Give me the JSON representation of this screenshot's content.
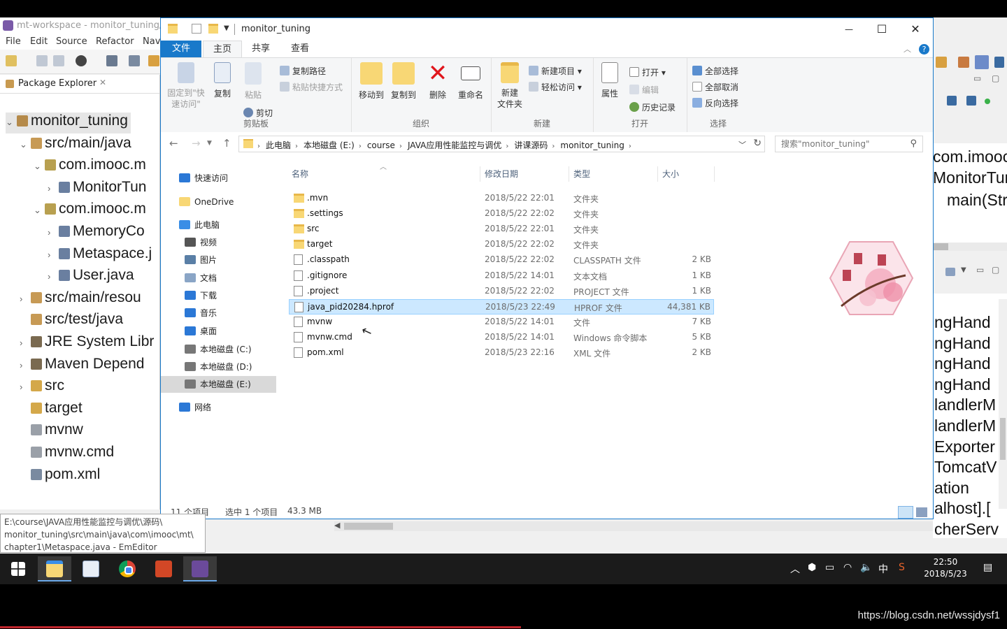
{
  "eclipse": {
    "title": "mt-workspace - monitor_tuning/s",
    "menu": [
      "File",
      "Edit",
      "Source",
      "Refactor",
      "Nav"
    ],
    "package_explorer": {
      "tab_label": "Package Explorer",
      "tree": [
        {
          "label": "monitor_tuning",
          "arrow": "v",
          "indent": 0,
          "icon": "project-icon"
        },
        {
          "label": "src/main/java",
          "arrow": "v",
          "indent": 1,
          "icon": "source-folder-icon"
        },
        {
          "label": "com.imooc.m",
          "arrow": "v",
          "indent": 2,
          "icon": "package-icon"
        },
        {
          "label": "MonitorTun",
          "arrow": ">",
          "indent": 3,
          "icon": "java-file-icon"
        },
        {
          "label": "com.imooc.m",
          "arrow": "v",
          "indent": 2,
          "icon": "package-icon"
        },
        {
          "label": "MemoryCo",
          "arrow": ">",
          "indent": 3,
          "icon": "java-file-icon"
        },
        {
          "label": "Metaspace.j",
          "arrow": ">",
          "indent": 3,
          "icon": "java-file-icon"
        },
        {
          "label": "User.java",
          "arrow": ">",
          "indent": 3,
          "icon": "java-file-icon"
        },
        {
          "label": "src/main/resou",
          "arrow": ">",
          "indent": 1,
          "icon": "source-folder-icon"
        },
        {
          "label": "src/test/java",
          "arrow": "",
          "indent": 1,
          "icon": "source-folder-icon"
        },
        {
          "label": "JRE System Libr",
          "arrow": ">",
          "indent": 1,
          "icon": "library-icon"
        },
        {
          "label": "Maven Depend",
          "arrow": ">",
          "indent": 1,
          "icon": "library-icon"
        },
        {
          "label": "src",
          "arrow": ">",
          "indent": 1,
          "icon": "folder-icon"
        },
        {
          "label": "target",
          "arrow": "",
          "indent": 1,
          "icon": "folder-icon"
        },
        {
          "label": "mvnw",
          "arrow": "",
          "indent": 1,
          "icon": "file-icon"
        },
        {
          "label": "mvnw.cmd",
          "arrow": "",
          "indent": 1,
          "icon": "file-icon"
        },
        {
          "label": "pom.xml",
          "arrow": "",
          "indent": 1,
          "icon": "xml-file-icon"
        }
      ]
    },
    "tooltip": {
      "line1": "E:\\course\\JAVA应用性能监控与调优\\源码\\",
      "line2": "monitor_tuning\\src\\main\\java\\com\\imooc\\mt\\",
      "line3": "chapter1\\Metaspace.java - EmEditor"
    },
    "right_editor_lines": [
      "com.imooc",
      "MonitorTur",
      "main(Str"
    ],
    "right_console_lines": [
      "ngHand",
      "ngHand",
      "ngHand",
      "ngHand",
      "landlerM",
      "landlerM",
      "Exporter",
      "TomcatV",
      "ation",
      "alhost].[",
      "cherServ"
    ]
  },
  "explorer": {
    "title": "monitor_tuning",
    "window_controls": {
      "minimize": "—",
      "maximize": "☐",
      "close": "✕"
    },
    "tabs": [
      "文件",
      "主页",
      "共享",
      "查看"
    ],
    "ribbon": {
      "clipboard": {
        "label": "剪贴板",
        "pin": "固定到\"快\n速访问\"",
        "copy": "复制",
        "paste": "粘贴",
        "copy_path": "复制路径",
        "paste_shortcut": "粘贴快捷方式",
        "cut": "剪切"
      },
      "organize": {
        "label": "组织",
        "move_to": "移动到",
        "copy_to": "复制到",
        "delete": "删除",
        "rename": "重命名"
      },
      "new": {
        "label": "新建",
        "new_folder": "新建\n文件夹",
        "new_item": "新建项目",
        "easy_access": "轻松访问"
      },
      "open": {
        "label": "打开",
        "properties": "属性",
        "open": "打开",
        "edit": "编辑",
        "history": "历史记录"
      },
      "select": {
        "label": "选择",
        "select_all": "全部选择",
        "select_none": "全部取消",
        "invert": "反向选择"
      }
    },
    "breadcrumbs": [
      "此电脑",
      "本地磁盘 (E:)",
      "course",
      "JAVA应用性能监控与调优",
      "讲课源码",
      "monitor_tuning"
    ],
    "search_placeholder": "搜索\"monitor_tuning\"",
    "nav": [
      {
        "label": "快速访问",
        "icon": "star-icon",
        "color": "#2b78d6"
      },
      {
        "label": "OneDrive",
        "icon": "onedrive-icon",
        "color": "#f8d775"
      },
      {
        "label": "此电脑",
        "icon": "pc-icon",
        "color": "#3a8ee6"
      },
      {
        "label": "视频",
        "icon": "video-icon",
        "color": "#555"
      },
      {
        "label": "图片",
        "icon": "picture-icon",
        "color": "#5a7fa6"
      },
      {
        "label": "文档",
        "icon": "document-icon",
        "color": "#8aa5c6"
      },
      {
        "label": "下载",
        "icon": "download-icon",
        "color": "#2b78d6"
      },
      {
        "label": "音乐",
        "icon": "music-icon",
        "color": "#2b78d6"
      },
      {
        "label": "桌面",
        "icon": "desktop-icon",
        "color": "#2b78d6"
      },
      {
        "label": "本地磁盘 (C:)",
        "icon": "drive-icon",
        "color": "#777"
      },
      {
        "label": "本地磁盘 (D:)",
        "icon": "drive-icon",
        "color": "#777"
      },
      {
        "label": "本地磁盘 (E:)",
        "icon": "drive-icon",
        "color": "#777"
      },
      {
        "label": "网络",
        "icon": "network-icon",
        "color": "#2b78d6"
      }
    ],
    "columns": {
      "name": "名称",
      "date": "修改日期",
      "type": "类型",
      "size": "大小"
    },
    "files": [
      {
        "name": ".mvn",
        "date": "2018/5/22 22:01",
        "type": "文件夹",
        "size": "",
        "kind": "folder"
      },
      {
        "name": ".settings",
        "date": "2018/5/22 22:02",
        "type": "文件夹",
        "size": "",
        "kind": "folder"
      },
      {
        "name": "src",
        "date": "2018/5/22 22:01",
        "type": "文件夹",
        "size": "",
        "kind": "folder"
      },
      {
        "name": "target",
        "date": "2018/5/22 22:02",
        "type": "文件夹",
        "size": "",
        "kind": "folder"
      },
      {
        "name": ".classpath",
        "date": "2018/5/22 22:02",
        "type": "CLASSPATH 文件",
        "size": "2 KB",
        "kind": "doc"
      },
      {
        "name": ".gitignore",
        "date": "2018/5/22 14:01",
        "type": "文本文档",
        "size": "1 KB",
        "kind": "doc"
      },
      {
        "name": ".project",
        "date": "2018/5/22 22:02",
        "type": "PROJECT 文件",
        "size": "1 KB",
        "kind": "doc"
      },
      {
        "name": "java_pid20284.hprof",
        "date": "2018/5/23 22:49",
        "type": "HPROF 文件",
        "size": "44,381 KB",
        "kind": "doc",
        "selected": true
      },
      {
        "name": "mvnw",
        "date": "2018/5/22 14:01",
        "type": "文件",
        "size": "7 KB",
        "kind": "doc"
      },
      {
        "name": "mvnw.cmd",
        "date": "2018/5/22 14:01",
        "type": "Windows 命令脚本",
        "size": "5 KB",
        "kind": "doc"
      },
      {
        "name": "pom.xml",
        "date": "2018/5/23 22:16",
        "type": "XML 文件",
        "size": "2 KB",
        "kind": "doc"
      }
    ],
    "status": {
      "count": "11 个项目",
      "selection": "选中 1 个项目",
      "size": "43.3 MB"
    }
  },
  "taskbar": {
    "clock_time": "22:50",
    "clock_date": "2018/5/23",
    "ime": "中"
  },
  "watermark": "https://blog.csdn.net/wssjdysf1"
}
